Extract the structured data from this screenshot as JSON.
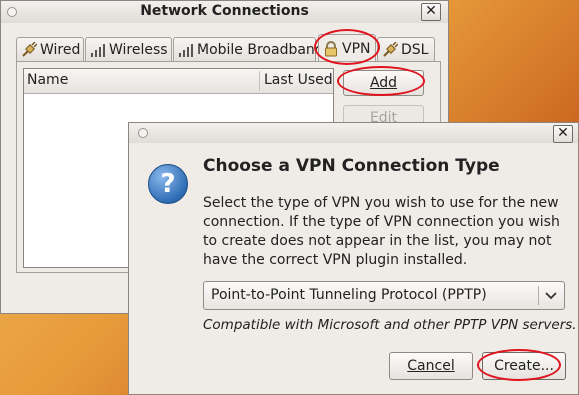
{
  "network_window": {
    "title": "Network Connections",
    "close_glyph": "✕",
    "tabs": [
      {
        "label": "Wired",
        "icon": "wired-plug-icon"
      },
      {
        "label": "Wireless",
        "icon": "wireless-bars-icon"
      },
      {
        "label": "Mobile Broadband",
        "icon": "mobile-bars-icon"
      },
      {
        "label": "VPN",
        "icon": "lock-icon",
        "selected": true
      },
      {
        "label": "DSL",
        "icon": "dsl-plug-icon"
      }
    ],
    "list_columns": [
      "Name",
      "Last Used"
    ],
    "buttons": {
      "add": "Add",
      "edit": "Edit"
    }
  },
  "vpn_dialog": {
    "close_glyph": "✕",
    "heading": "Choose a VPN Connection Type",
    "description": "Select the type of VPN you wish to use for the new connection.  If the type of VPN connection you wish to create does not appear in the list, you may not have the correct VPN plugin installed.",
    "vpn_type_selected": "Point-to-Point Tunneling Protocol (PPTP)",
    "vpn_type_hint": "Compatible with Microsoft and other PPTP VPN servers.",
    "buttons": {
      "cancel": "Cancel",
      "create": "Create..."
    },
    "icon": "question-icon"
  },
  "colors": {
    "annotation_ring": "#e0141e",
    "question_icon": "#2f6db5"
  }
}
